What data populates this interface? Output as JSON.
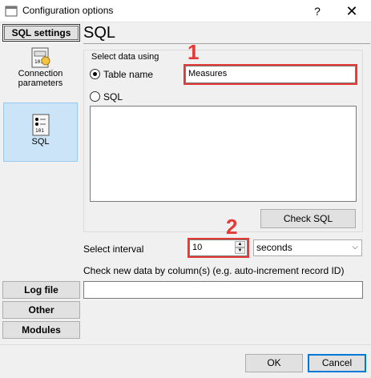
{
  "window": {
    "title": "Configuration options",
    "help_label": "?",
    "close_label": "✕"
  },
  "nav": {
    "sql_settings": "SQL settings",
    "log_file": "Log file",
    "other": "Other",
    "modules": "Modules",
    "sub_items": [
      {
        "label": "Connection parameters",
        "icon": "connection-parameters-icon",
        "selected": false
      },
      {
        "label": "SQL",
        "icon": "sql-icon",
        "selected": true
      }
    ]
  },
  "page": {
    "title": "SQL"
  },
  "select_data": {
    "group_label": "Select data using",
    "table_name_label": "Table name",
    "table_name_value": "Measures",
    "sql_label": "SQL",
    "sql_text": "",
    "selected_option": "Table name",
    "check_sql_label": "Check SQL"
  },
  "interval": {
    "label": "Select interval",
    "value": "10",
    "unit": "seconds"
  },
  "check_new": {
    "label": "Check new data by column(s) (e.g. auto-increment record ID)",
    "value": ""
  },
  "callouts": {
    "one": "1",
    "two": "2"
  },
  "footer": {
    "ok_label": "OK",
    "cancel_label": "Cancel"
  },
  "colors": {
    "callout_red": "#e53935",
    "selected_bg": "#cce4f7",
    "accent_blue": "#0078d7"
  }
}
